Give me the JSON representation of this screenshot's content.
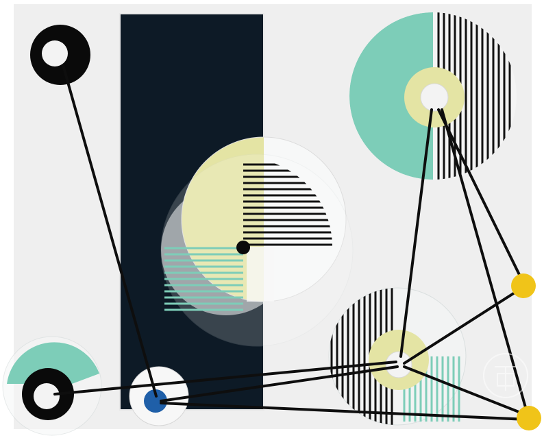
{
  "artwork": {
    "description_tag": "",
    "colors": {
      "background": "#ffffff",
      "wall": "#efefef",
      "panel": "#0d1a26",
      "teal": "#7dcdb8",
      "yellow_green": "#e4e4a4",
      "translucent_white": "#f6f7f7",
      "stripe": "#111111",
      "rod": "#0e0e0e",
      "ball_white": "#f3f3f3",
      "ball_yellow": "#f0c419",
      "ball_blue": "#1f5fa8",
      "ball_black": "#0a0a0a"
    },
    "elements": [
      "black-ring-disc",
      "dark-vertical-panel",
      "center-yellow-white-disc",
      "top-right-teal-disc",
      "bottom-right-striped-disc",
      "bottom-left-teal-disc",
      "blue-ball-white-disc",
      "yellow-balls",
      "connecting-rods",
      "logo-watermark"
    ]
  }
}
